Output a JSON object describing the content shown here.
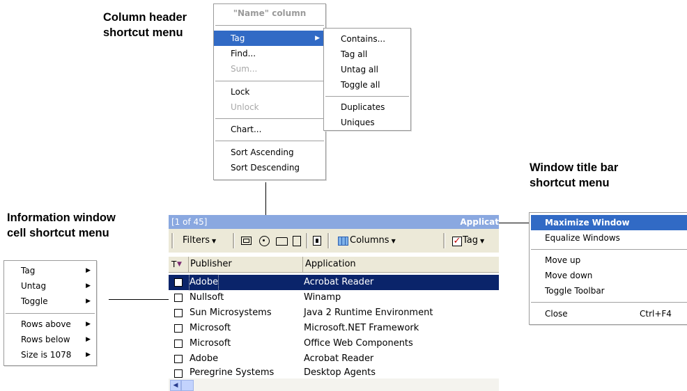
{
  "captions": {
    "column_header": [
      "Column header",
      "shortcut menu"
    ],
    "title_bar": [
      "Window title bar",
      "shortcut menu"
    ],
    "info_cell": [
      "Information window",
      "cell shortcut menu"
    ]
  },
  "column_menu": {
    "header": "\"Name\" column",
    "items": [
      "Tag",
      "Find...",
      "Sum...",
      "Lock",
      "Unlock",
      "Chart...",
      "Sort Ascending",
      "Sort Descending"
    ],
    "submenu": [
      "Contains...",
      "Tag all",
      "Untag all",
      "Toggle all",
      "Duplicates",
      "Uniques"
    ]
  },
  "title_menu": {
    "items": [
      "Maximize Window",
      "Equalize Windows",
      "Move up",
      "Move down",
      "Toggle Toolbar",
      "Close"
    ],
    "close_shortcut": "Ctrl+F4"
  },
  "cell_menu": {
    "items": [
      "Tag",
      "Untag",
      "Toggle",
      "Rows above",
      "Rows below",
      "Size is 1078"
    ]
  },
  "window": {
    "title_left": "[1 of 45]",
    "title_right": "Applicat",
    "toolbar": {
      "filters": "Filters",
      "columns": "Columns",
      "tag": "Tag"
    },
    "columns": [
      "Publisher",
      "Application"
    ],
    "tag_col_label": "T",
    "rows": [
      [
        "Adobe",
        "Acrobat Reader"
      ],
      [
        "Nullsoft",
        "Winamp"
      ],
      [
        "Sun Microsystems",
        "Java 2 Runtime Environment"
      ],
      [
        "Microsoft",
        "Microsoft.NET Framework"
      ],
      [
        "Microsoft",
        "Office Web Components"
      ],
      [
        "Adobe",
        "Acrobat Reader"
      ],
      [
        "Peregrine Systems",
        "Desktop Agents"
      ]
    ]
  },
  "colors": {
    "selection": "#0a246a",
    "title_bar": "#8aa8e0",
    "menu_highlight": "#316ac5",
    "menu_border": "#9a9a9a"
  }
}
